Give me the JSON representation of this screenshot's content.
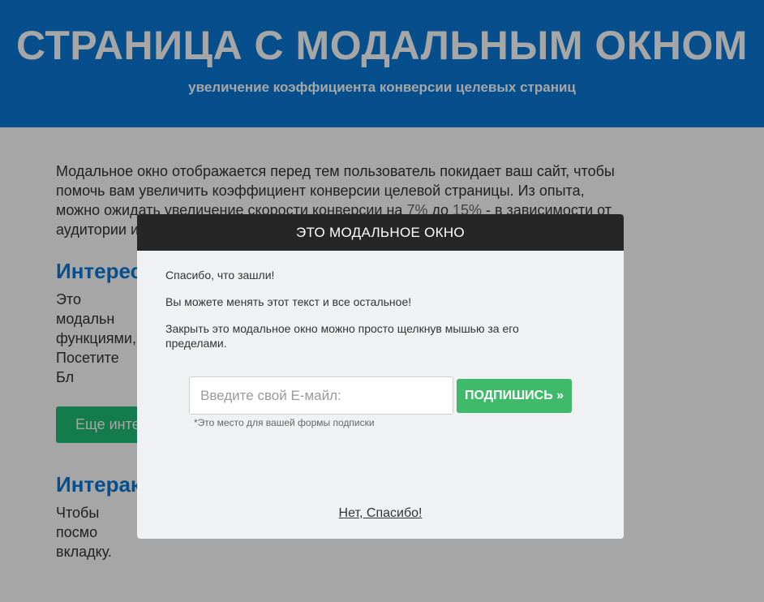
{
  "hero": {
    "title": "СТРАНИЦА С МОДАЛЬНЫМ ОКНОМ",
    "subtitle": "увеличение коэффициента конверсии целевых страниц"
  },
  "content": {
    "intro_part1": "Модальное окно отображается перед тем пользователь покидает ваш сайт, чтобы помочь вам увеличить коэффициент конверсии целевой страницы. Из опыта, можно ожидать увеличение скорости конверсии на ",
    "intro_pct_from": "7%",
    "intro_part2": " до ",
    "intro_pct_to": "15%",
    "intro_part3": " - в зависимости от аудитории и",
    "section1_title": "Интерес",
    "section1_text": "Это модальн функциями, Посетите Бл",
    "more_button": "Еще инте",
    "section2_title": "Интеракт",
    "section2_text": "Чтобы посмо вкладку."
  },
  "modal": {
    "title": "ЭТО МОДАЛЬНОЕ ОКНО",
    "line1": "Спасибо, что зашли!",
    "line2": "Вы можете менять этот текст и все остальное!",
    "line3": "Закрыть это модальное окно можно просто щелкнув мышью за его пределами.",
    "email_placeholder": "Введите свой E-майл:",
    "subscribe_label": "ПОДПИШИСЬ »",
    "form_note": "*Это место для вашей формы подписки",
    "no_thanks": "Нет, Спасибо!"
  },
  "colors": {
    "hero_bg": "#0a7ad8",
    "modal_header_bg": "#262626",
    "subscribe_bg": "#3fba6b",
    "more_button_bg": "#1fbf76"
  }
}
